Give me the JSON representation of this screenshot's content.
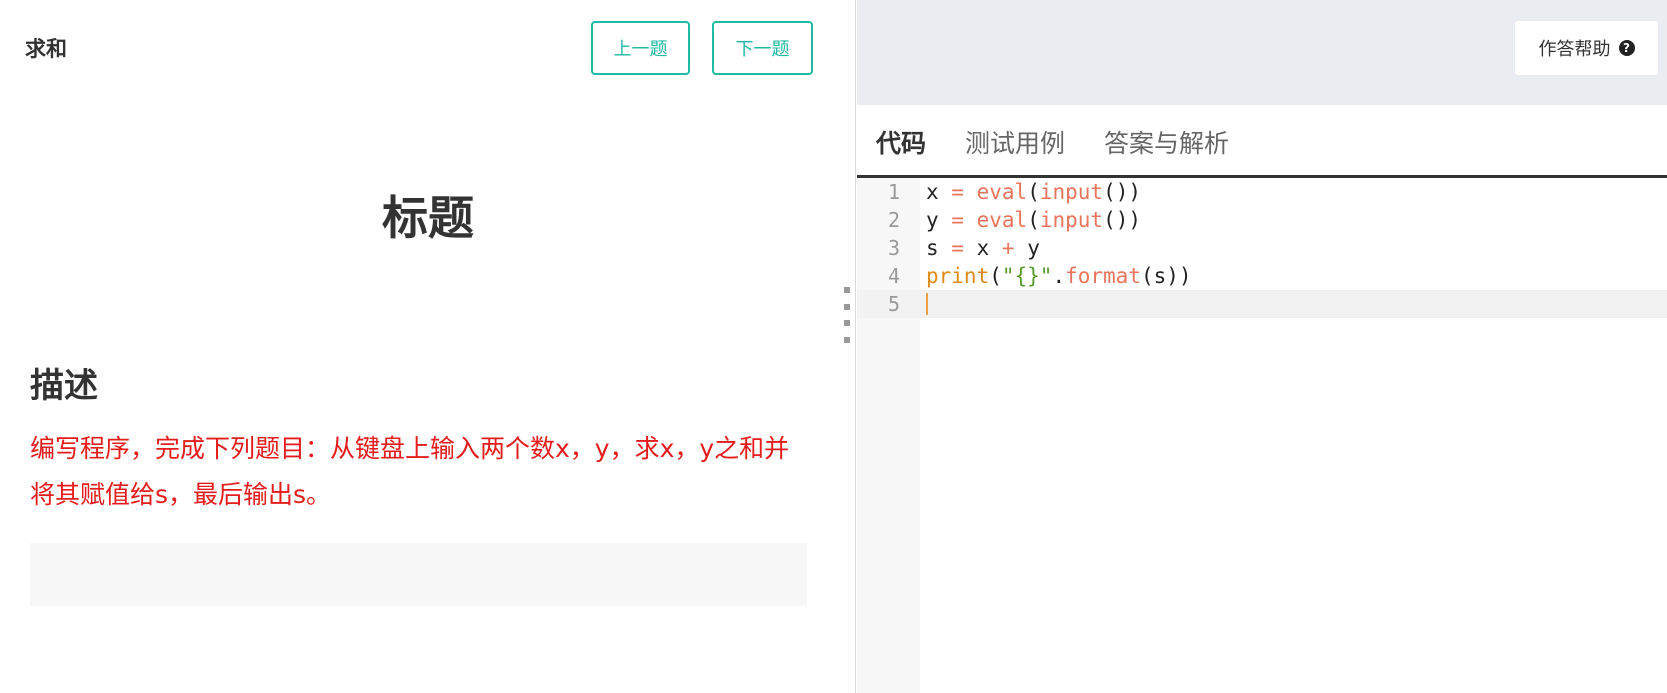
{
  "problem": {
    "name": "求和",
    "prev_label": "上一题",
    "next_label": "下一题",
    "title": "标题",
    "section_heading": "描述",
    "description": "编写程序，完成下列题目：从键盘上输入两个数x，y，求x，y之和并将其赋值给s，最后输出s。"
  },
  "toolbar": {
    "help_label": "作答帮助",
    "help_icon": "question-circle-icon"
  },
  "tabs": [
    {
      "label": "代码",
      "active": true
    },
    {
      "label": "测试用例",
      "active": false
    },
    {
      "label": "答案与解析",
      "active": false
    }
  ],
  "editor": {
    "line_numbers": [
      "1",
      "2",
      "3",
      "4",
      "5"
    ],
    "lines": [
      "x = eval(input())",
      "y = eval(input())",
      "s = x + y",
      "print(\"{}\".format(s))",
      ""
    ],
    "current_line": 5
  },
  "colors": {
    "accent": "#20b9a4",
    "description_text": "#e41c1c",
    "topbar_bg": "#e9ecf0"
  }
}
